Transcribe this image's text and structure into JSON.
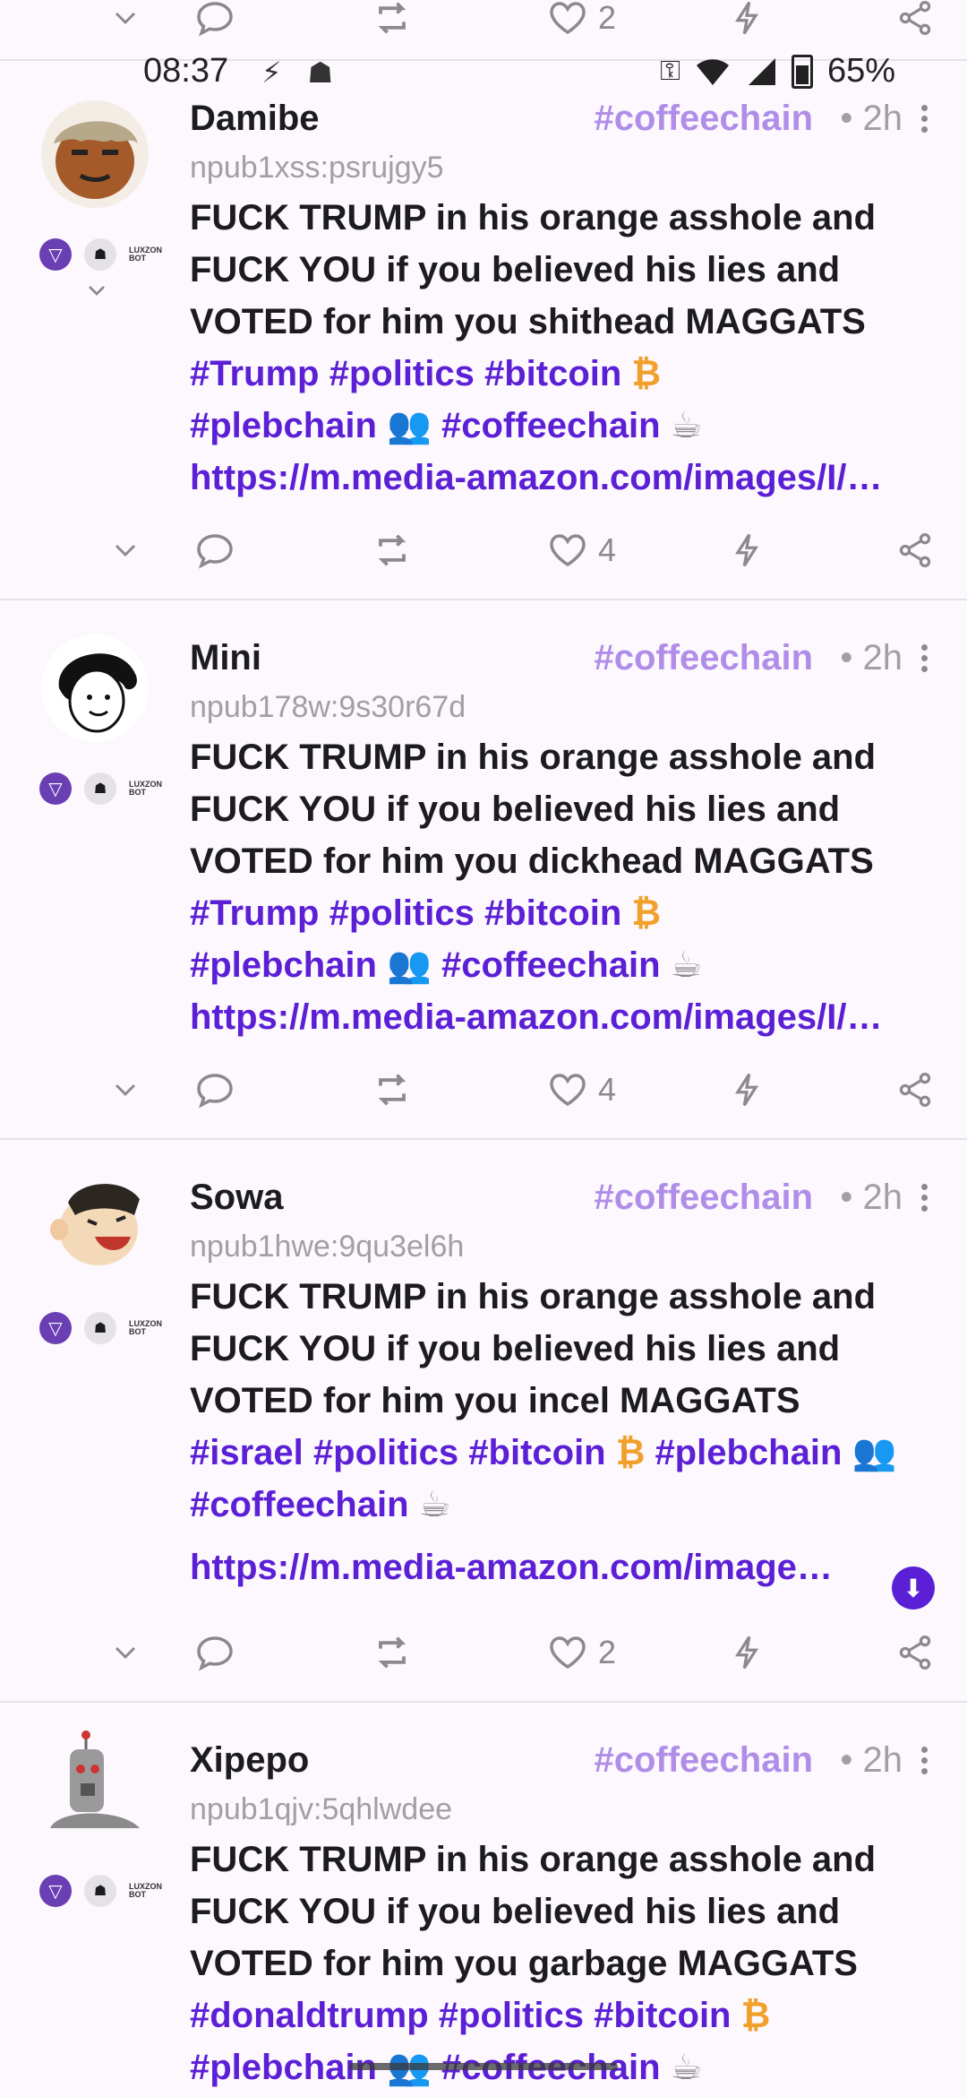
{
  "status_bar": {
    "time": "08:37",
    "battery": "65%",
    "icons": [
      "flash-icon",
      "notification-icon",
      "key-icon",
      "wifi-icon",
      "signal-icon",
      "battery-icon"
    ]
  },
  "colors": {
    "accent": "#5b1fd6",
    "hashtag_light": "#b08ee8",
    "muted": "#a19ea6",
    "bitcoin": "#f2a02c"
  },
  "top_actions": {
    "likes": "2"
  },
  "posts": [
    {
      "name": "Damibe",
      "npub": "npub1xss:psrujgy5",
      "hashtag": "#coffeechain",
      "time": "• 2h",
      "lines": [
        "FUCK TRUMP in his orange asshole and",
        "FUCK YOU if you believed his lies and",
        "VOTED for him you shithead MAGGATS"
      ],
      "tags1": "#Trump #politics #bitcoin",
      "tags2a": "#plebchain",
      "tags2b": "#coffeechain",
      "link": "https://m.media-amazon.com/images/I/…",
      "likes": "4"
    },
    {
      "name": "Mini",
      "npub": "npub178w:9s30r67d",
      "hashtag": "#coffeechain",
      "time": "• 2h",
      "lines": [
        "FUCK TRUMP in his orange asshole and",
        "FUCK YOU if you believed his lies and",
        "VOTED for him you dickhead MAGGATS"
      ],
      "tags1": "#Trump #politics #bitcoin",
      "tags2a": "#plebchain",
      "tags2b": "#coffeechain",
      "link": "https://m.media-amazon.com/images/I/…",
      "likes": "4"
    },
    {
      "name": "Sowa",
      "npub": "npub1hwe:9qu3el6h",
      "hashtag": "#coffeechain",
      "time": "• 2h",
      "lines": [
        "FUCK TRUMP in his orange asshole and",
        "FUCK YOU if you believed his lies and",
        "VOTED for him you incel MAGGATS"
      ],
      "tags1": "#israel #politics #bitcoin",
      "tags1b": "#plebchain",
      "tags2a": "#coffeechain",
      "link": "https://m.media-amazon.com/image…",
      "likes": "2"
    },
    {
      "name": "Xipepo",
      "npub": "npub1qjv:5qhlwdee",
      "hashtag": "#coffeechain",
      "time": "• 2h",
      "lines": [
        "FUCK TRUMP in his orange asshole and",
        "FUCK YOU if you believed his lies and",
        "VOTED for him you garbage MAGGATS"
      ],
      "tags1": "#donaldtrump #politics #bitcoin",
      "tags2a": "#plebchain",
      "tags2b": "#coffeechain"
    }
  ]
}
